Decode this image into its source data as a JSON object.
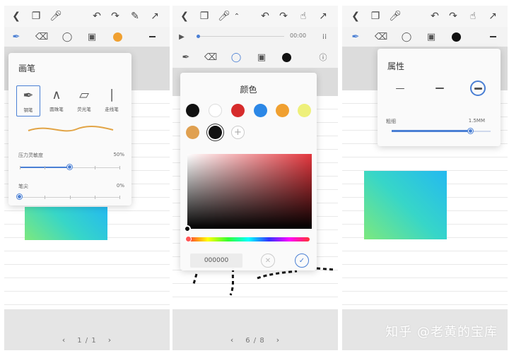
{
  "colors": {
    "accent": "#4a7fd4",
    "swatches": [
      "#111111",
      "#ffffff",
      "#d62b2b",
      "#2b87e6",
      "#f0a030",
      "#eef07a",
      "#e0a050",
      "#111111"
    ]
  },
  "panel1": {
    "popover": {
      "title": "画笔",
      "pens": [
        {
          "label": "钢笔",
          "icon": "fountain-pen-icon"
        },
        {
          "label": "圆珠笔",
          "icon": "ballpoint-pen-icon"
        },
        {
          "label": "荧光笔",
          "icon": "highlighter-icon"
        },
        {
          "label": "走线笔",
          "icon": "marker-pen-icon"
        }
      ],
      "pressure_label": "压力灵敏度",
      "pressure_value": "50%",
      "pressure_level": 0.5,
      "tip_label": "笔尖",
      "tip_value": "0%",
      "tip_level": 0
    },
    "page_indicator": "1 / 1"
  },
  "panel2": {
    "audio_time": "00:00",
    "popover": {
      "title": "颜色",
      "hex_value": "000000"
    },
    "page_indicator": "6 / 8"
  },
  "panel3": {
    "popover": {
      "title": "属性",
      "thickness_label": "粗细",
      "thickness_value": "1.5MM",
      "thickness_level": 0.8
    }
  },
  "watermark": "知乎 @老黄的宝库"
}
